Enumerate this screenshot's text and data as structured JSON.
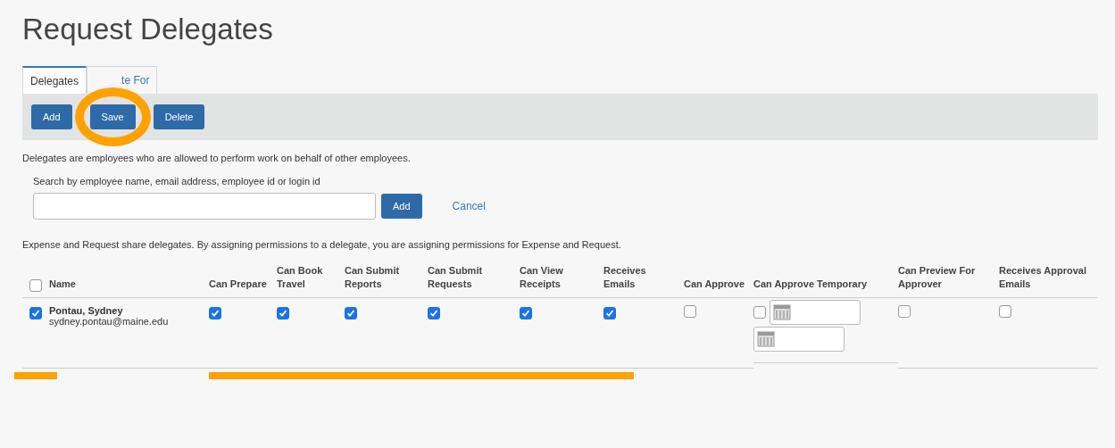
{
  "title": "Request Delegates",
  "tabs": [
    {
      "label": "Delegates",
      "selected": true
    },
    {
      "label": "te For",
      "selected": false
    }
  ],
  "toolbar": [
    "Add",
    "Save",
    "Delete"
  ],
  "description": "Delegates are employees who are allowed to perform work on behalf of other employees.",
  "search": {
    "label": "Search by employee name, email address, employee id or login id",
    "button": "Add",
    "cancel": "Cancel"
  },
  "note": "Expense and Request share delegates. By assigning permissions to a delegate, you are assigning permissions for Expense and Request.",
  "table": {
    "all_selected": false,
    "columns": [
      "Name",
      "Can Prepare",
      "Can Book Travel",
      "Can Submit Reports",
      "Can Submit Requests",
      "Can View Receipts",
      "Receives Emails",
      "Can Approve",
      "Can Approve Temporary",
      "Can Preview For Approver",
      "Receives Approval Emails"
    ],
    "rows": [
      {
        "selected": true,
        "name": "Pontau, Sydney",
        "email": "sydney.pontau@maine.edu",
        "cells": [
          {
            "kind": "checkbox",
            "checked": true
          },
          {
            "kind": "checkbox",
            "checked": true
          },
          {
            "kind": "checkbox",
            "checked": true
          },
          {
            "kind": "checkbox",
            "checked": true
          },
          {
            "kind": "checkbox",
            "checked": true
          },
          {
            "kind": "checkbox",
            "checked": true
          },
          {
            "kind": "checkbox",
            "checked": false
          },
          {
            "kind": "temporary",
            "checked": false
          },
          {
            "kind": "checkbox",
            "checked": false
          },
          {
            "kind": "checkbox",
            "checked": false
          }
        ]
      }
    ]
  }
}
